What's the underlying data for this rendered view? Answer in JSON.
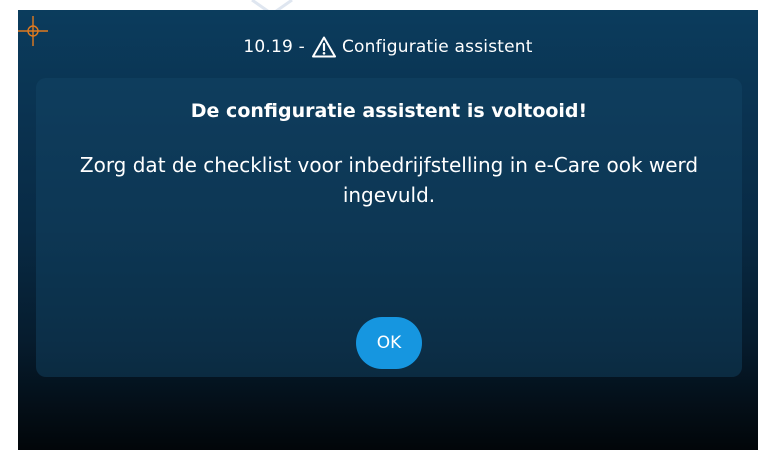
{
  "header": {
    "code": "10.19 -",
    "title": "Configuratie assistent",
    "warning_icon": "warning-triangle-icon",
    "crosshair_icon": "crosshair-icon"
  },
  "dialog": {
    "heading": "De configuratie assistent is voltooid!",
    "message": "Zorg dat de checklist voor inbedrijfstelling in e-Care ook werd ingevuld.",
    "ok_label": "OK"
  },
  "colors": {
    "accent": "#1696e0",
    "crosshair": "#e07a1f",
    "background_top": "#0b3c5d",
    "background_bottom": "#020609"
  }
}
